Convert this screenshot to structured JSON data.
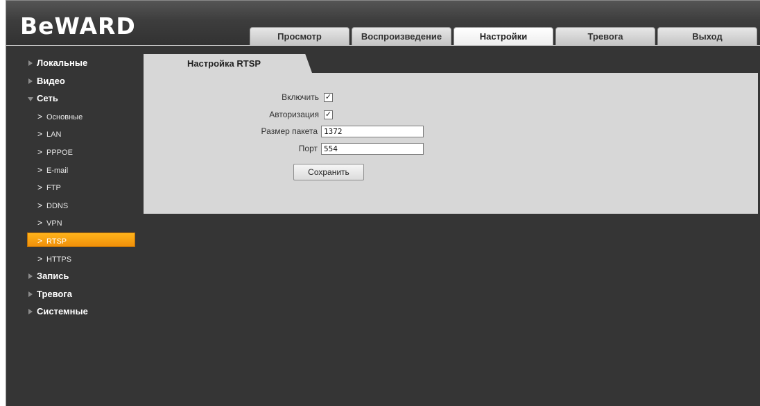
{
  "brand": {
    "logo_text": "BeWARD"
  },
  "tabs": [
    {
      "label": "Просмотр",
      "active": false
    },
    {
      "label": "Воспроизведение",
      "active": false
    },
    {
      "label": "Настройки",
      "active": true
    },
    {
      "label": "Тревога",
      "active": false
    },
    {
      "label": "Выход",
      "active": false
    }
  ],
  "sidebar": {
    "items": [
      {
        "label": "Локальные"
      },
      {
        "label": "Видео"
      },
      {
        "label": "Сеть",
        "expanded": true,
        "children": [
          "Основные",
          "LAN",
          "PPPOE",
          "E-mail",
          "FTP",
          "DDNS",
          "VPN",
          "RTSP",
          "HTTPS"
        ],
        "active_child": "RTSP"
      },
      {
        "label": "Запись"
      },
      {
        "label": "Тревога"
      },
      {
        "label": "Системные"
      }
    ]
  },
  "content": {
    "title": "Настройка RTSP",
    "enable_label": "Включить",
    "enable_checked": true,
    "auth_label": "Авторизация",
    "auth_checked": true,
    "packet_label": "Размер пакета",
    "packet_value": "1372",
    "port_label": "Порт",
    "port_value": "554",
    "save_label": "Сохранить"
  },
  "colors": {
    "background": "#353535",
    "active_accent": "#ffa514",
    "panel": "#d7d7d7"
  },
  "icons": {
    "expand": "triangle-right-icon",
    "collapse": "triangle-down-icon",
    "submenu": "chevron-right-icon",
    "check": "checkmark-icon"
  }
}
